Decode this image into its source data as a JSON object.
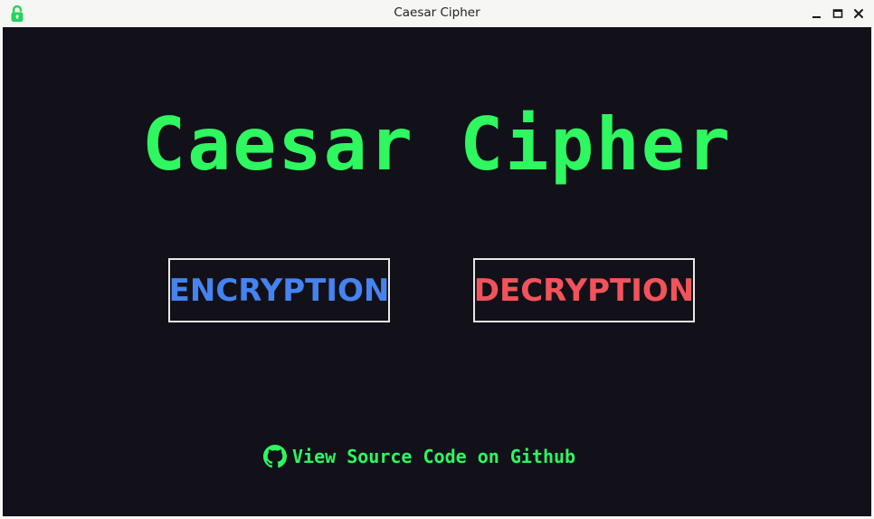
{
  "window": {
    "title": "Caesar Cipher",
    "controls": [
      "minimize",
      "maximize",
      "close"
    ]
  },
  "colors": {
    "accent_green": "#2ef760",
    "encrypt_blue": "#4583f0",
    "decrypt_red": "#f2535a",
    "background": "#12111a"
  },
  "main": {
    "heading": "Caesar Cipher",
    "encrypt_label": "ENCRYPTION",
    "decrypt_label": "DECRYPTION",
    "github_link_label": "View Source Code on Github"
  },
  "icons": {
    "app_icon": "lock-icon",
    "link_icon": "github-icon"
  }
}
